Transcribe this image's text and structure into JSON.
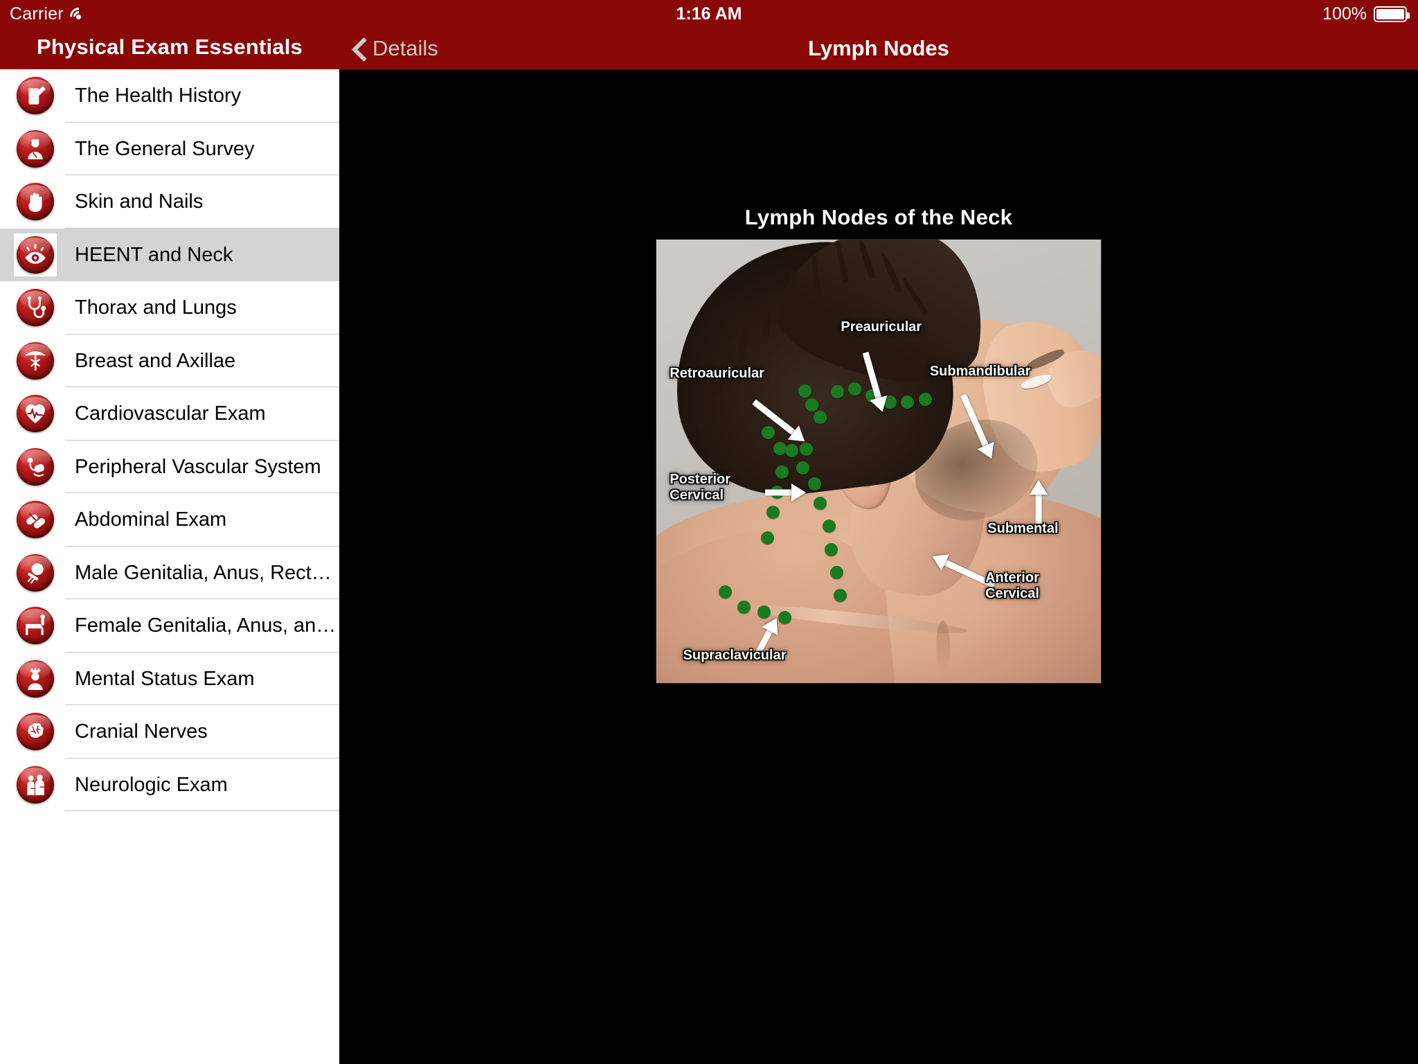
{
  "status_bar": {
    "carrier": "Carrier",
    "wifi_icon": "wifi-icon",
    "time": "1:16 AM",
    "battery_percent": "100%",
    "battery_icon": "battery-full-icon"
  },
  "sidebar": {
    "title": "Physical Exam Essentials",
    "items": [
      {
        "label": "The Health History",
        "icon": "clipboard-pen-icon",
        "selected": false
      },
      {
        "label": "The General Survey",
        "icon": "doctor-icon",
        "selected": false
      },
      {
        "label": "Skin and Nails",
        "icon": "hand-icon",
        "selected": false
      },
      {
        "label": "HEENT and Neck",
        "icon": "eye-icon",
        "selected": true
      },
      {
        "label": "Thorax and Lungs",
        "icon": "stethoscope-icon",
        "selected": false
      },
      {
        "label": "Breast and Axillae",
        "icon": "caduceus-icon",
        "selected": false
      },
      {
        "label": "Cardiovascular Exam",
        "icon": "heart-ecg-icon",
        "selected": false
      },
      {
        "label": "Peripheral Vascular System",
        "icon": "blood-pressure-icon",
        "selected": false
      },
      {
        "label": "Abdominal Exam",
        "icon": "pills-icon",
        "selected": false
      },
      {
        "label": "Male Genitalia, Anus, Rectu…",
        "icon": "male-exam-icon",
        "selected": false
      },
      {
        "label": "Female Genitalia, Anus, and…",
        "icon": "exam-table-icon",
        "selected": false
      },
      {
        "label": "Mental Status Exam",
        "icon": "mind-person-icon",
        "selected": false
      },
      {
        "label": "Cranial Nerves",
        "icon": "brain-icon",
        "selected": false
      },
      {
        "label": "Neurologic Exam",
        "icon": "two-people-icon",
        "selected": false
      }
    ]
  },
  "detail": {
    "back_label": "Details",
    "back_icon": "chevron-left-icon",
    "title": "Lymph Nodes",
    "figure": {
      "caption": "Lymph Nodes of the Neck",
      "image_alt": "photo-lateral-neck-lymph-nodes",
      "node_color": "#1a7a22",
      "annotations": [
        {
          "label": "Preauricular"
        },
        {
          "label": "Submandibular"
        },
        {
          "label": "Retroauricular"
        },
        {
          "label": "Posterior\nCervical"
        },
        {
          "label": "Submental"
        },
        {
          "label": "Anterior\nCervical"
        },
        {
          "label": "Supraclavicular"
        }
      ]
    }
  },
  "colors": {
    "brand_red": "#8a0707",
    "selected_row": "#d4d4d4",
    "detail_background": "#000000",
    "node_green": "#1a7a22"
  }
}
